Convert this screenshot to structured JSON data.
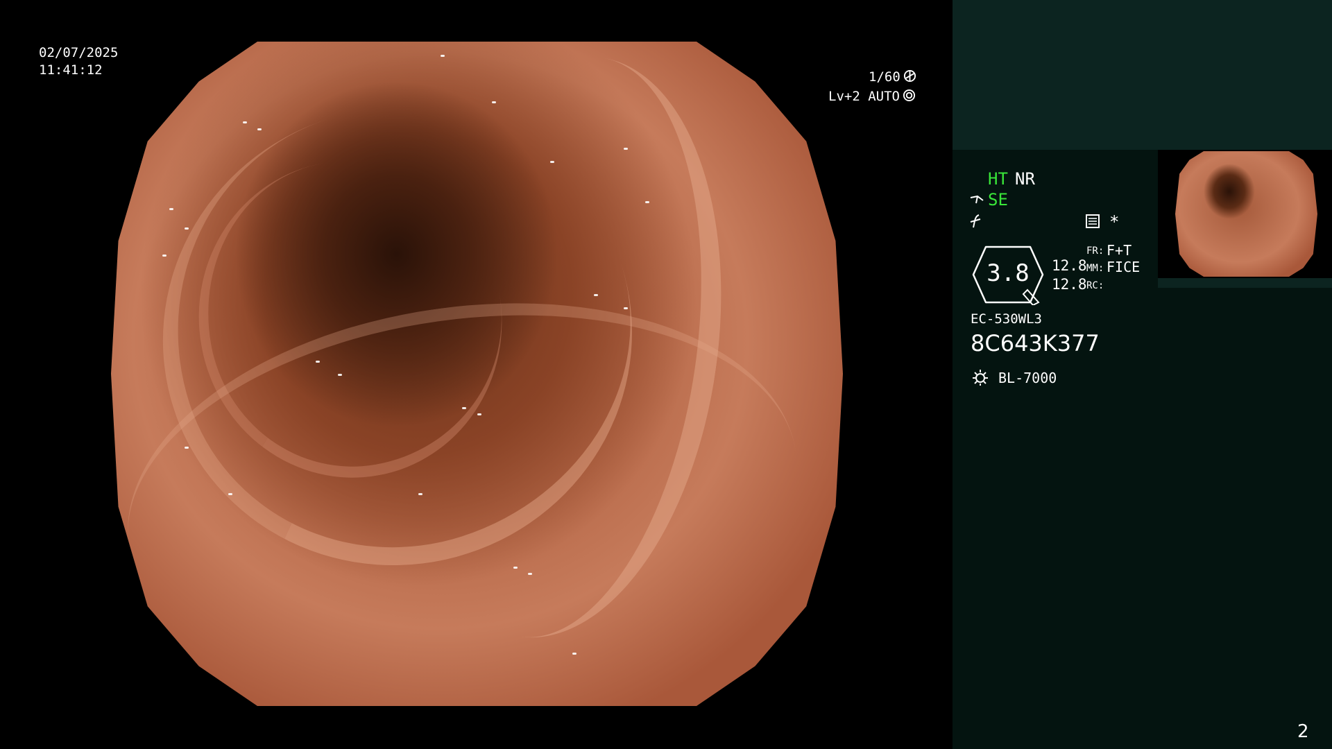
{
  "scope": {
    "date": "02/07/2025",
    "time": "11:41:12",
    "shutter": "1/60",
    "level": "Lv+2 AUTO"
  },
  "panel": {
    "ht_label": "HT",
    "nr_label": "NR",
    "se_label": "SE",
    "star": "*",
    "gauge_value": "3.8",
    "val1": "12.8",
    "val2": "12.8",
    "fr_label": "FR:",
    "fr_value": "F+T",
    "mm_label": "MM:",
    "mm_value": "FICE",
    "rc_label": "RC:",
    "scope_model": "EC-530WL3",
    "serial": "8C643K377",
    "light_source": "BL-7000",
    "page_number": "2"
  },
  "colors": {
    "panel_bg": "#041410",
    "panel_top_bg": "#0c2420",
    "accent_green": "#39e639"
  },
  "icons": [
    "shutter-icon",
    "iris-icon",
    "scope-tip-icon",
    "freeze-icon",
    "memory-icon",
    "light-source-icon"
  ]
}
